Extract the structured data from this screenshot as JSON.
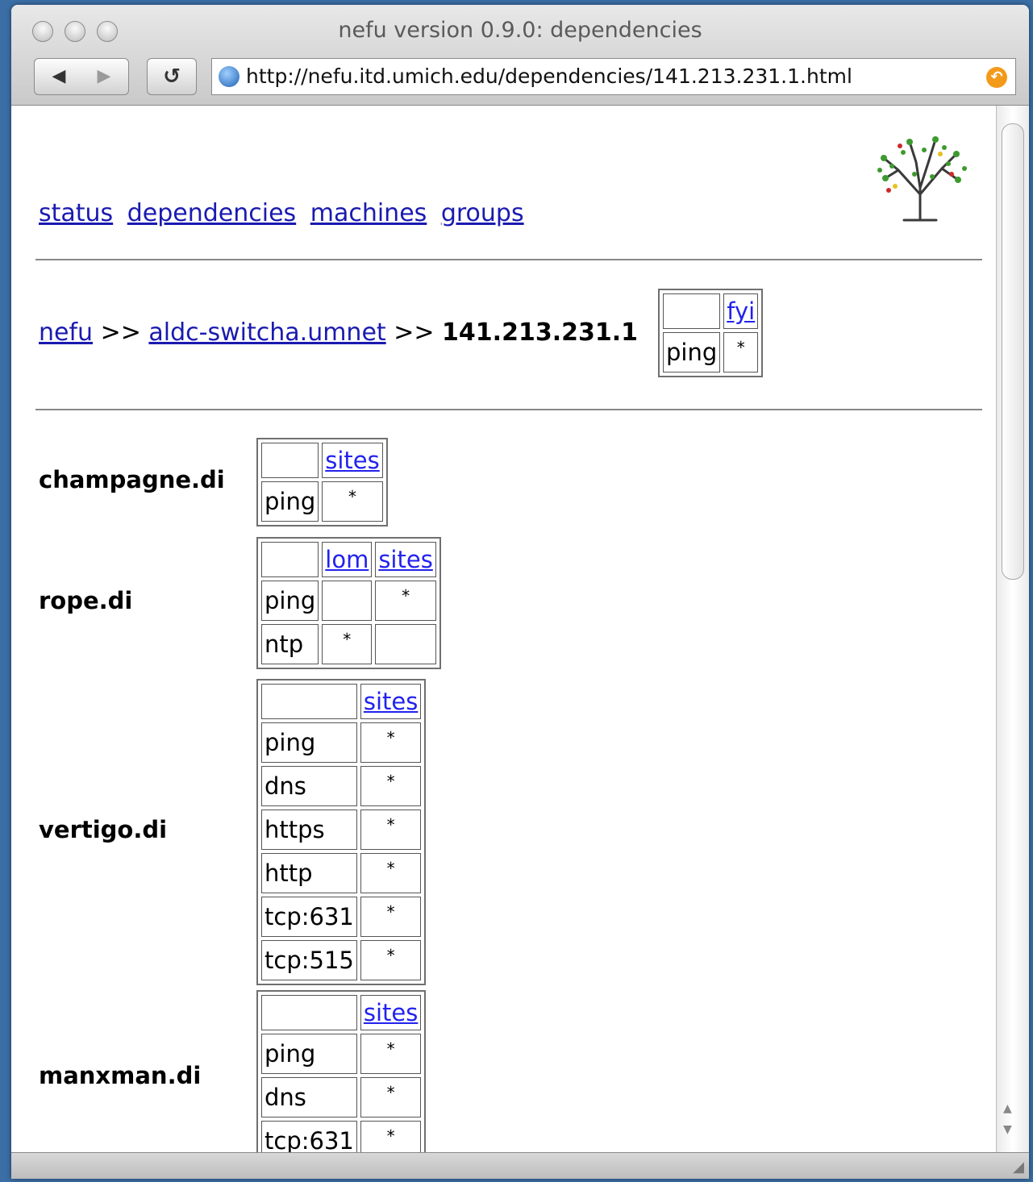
{
  "window": {
    "title": "nefu version 0.9.0: dependencies",
    "url": "http://nefu.itd.umich.edu/dependencies/141.213.231.1.html",
    "back_glyph": "◀",
    "forward_glyph": "▶",
    "reload_glyph": "↺",
    "snapback_glyph": "↶"
  },
  "nav": {
    "status": "status",
    "dependencies": "dependencies",
    "machines": "machines",
    "groups": "groups"
  },
  "breadcrumb": {
    "root": "nefu",
    "sep": ">>",
    "parent": "aldc-switcha.umnet",
    "current": "141.213.231.1"
  },
  "header_table": {
    "columns": [
      "fyi"
    ],
    "rows": [
      {
        "service": "ping",
        "cells": [
          "*"
        ]
      }
    ]
  },
  "hosts": [
    {
      "name": "champagne.di",
      "columns": [
        "sites"
      ],
      "rows": [
        {
          "service": "ping",
          "cells": [
            "*"
          ]
        }
      ]
    },
    {
      "name": "rope.di",
      "columns": [
        "lom",
        "sites"
      ],
      "rows": [
        {
          "service": "ping",
          "cells": [
            "",
            "*"
          ]
        },
        {
          "service": "ntp",
          "cells": [
            "*",
            ""
          ]
        }
      ]
    },
    {
      "name": "vertigo.di",
      "columns": [
        "sites"
      ],
      "rows": [
        {
          "service": "ping",
          "cells": [
            "*"
          ]
        },
        {
          "service": "dns",
          "cells": [
            "*"
          ]
        },
        {
          "service": "https",
          "cells": [
            "*"
          ]
        },
        {
          "service": "http",
          "cells": [
            "*"
          ]
        },
        {
          "service": "tcp:631",
          "cells": [
            "*"
          ]
        },
        {
          "service": "tcp:515",
          "cells": [
            "*"
          ]
        }
      ]
    },
    {
      "name": "manxman.di",
      "columns": [
        "sites"
      ],
      "rows": [
        {
          "service": "ping",
          "cells": [
            "*"
          ]
        },
        {
          "service": "dns",
          "cells": [
            "*"
          ]
        },
        {
          "service": "tcp:631",
          "cells": [
            "*"
          ]
        }
      ]
    }
  ],
  "colors": {
    "link": "#1a1ab0",
    "column_link": "#2222ee",
    "desktop": "#3a6ea5"
  },
  "icons": {
    "logo": "tree-logo-icon",
    "globe": "globe-icon",
    "snapback": "snapback-icon"
  }
}
